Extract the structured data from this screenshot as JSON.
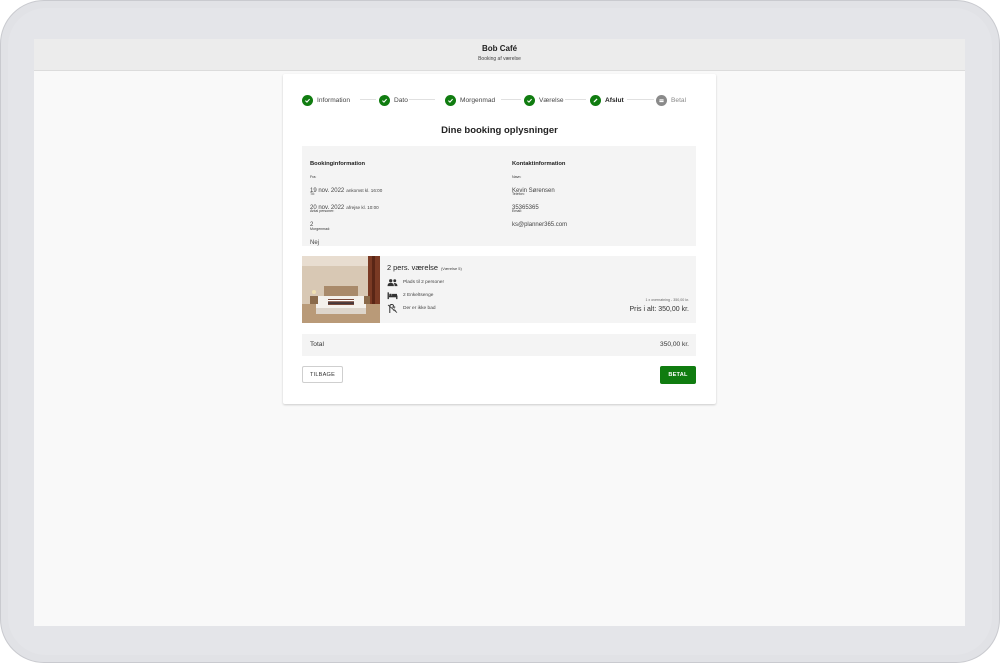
{
  "app": {
    "title": "Bob Café",
    "subtitle": "Booking af værelse"
  },
  "stepper": {
    "steps": [
      {
        "label": "Information",
        "status": "done"
      },
      {
        "label": "Dato",
        "status": "done"
      },
      {
        "label": "Morgenmad",
        "status": "done"
      },
      {
        "label": "Værelse",
        "status": "done"
      },
      {
        "label": "Afslut",
        "status": "current"
      },
      {
        "label": "Betal",
        "status": "pending"
      }
    ]
  },
  "heading": "Dine booking oplysninger",
  "booking_info": {
    "title": "Bookinginformation",
    "from_label": "Fra:",
    "from_date": "19 nov. 2022",
    "arrival": "ankomst kl. 16:00",
    "to_label": "Til:",
    "to_date": "20 nov. 2022",
    "departure": "afrejse kl. 10:00",
    "guests_label": "Antal personer:",
    "guests": "2",
    "breakfast_label": "Morgenmad:",
    "breakfast": "Nej"
  },
  "contact_info": {
    "title": "Kontaktinformation",
    "name_label": "Navn:",
    "name": "Kevin Sørensen",
    "phone_label": "Telefon:",
    "phone": "35365365",
    "email_label": "Email:",
    "email": "ks@planner365.com"
  },
  "room": {
    "title": "2 pers. værelse",
    "room_number": "(Værelse 5)",
    "features": [
      "Plads til 2 personer",
      "2 Enkeltsenge",
      "Der er ikke bad"
    ],
    "price_note": "1 x overnatning - 350,00 kr.",
    "price_total": "Pris i alt: 350,00 kr."
  },
  "total": {
    "label": "Total",
    "amount": "350,00 kr."
  },
  "actions": {
    "back": "TILBAGE",
    "pay": "BETAL"
  },
  "colors": {
    "accent": "#107c10",
    "pending": "#8a8a8a",
    "panel": "#f4f4f4"
  },
  "icons": [
    "check-icon",
    "edit-pencil-icon",
    "payment-card-icon",
    "people-icon",
    "bed-icon",
    "shower-icon"
  ]
}
